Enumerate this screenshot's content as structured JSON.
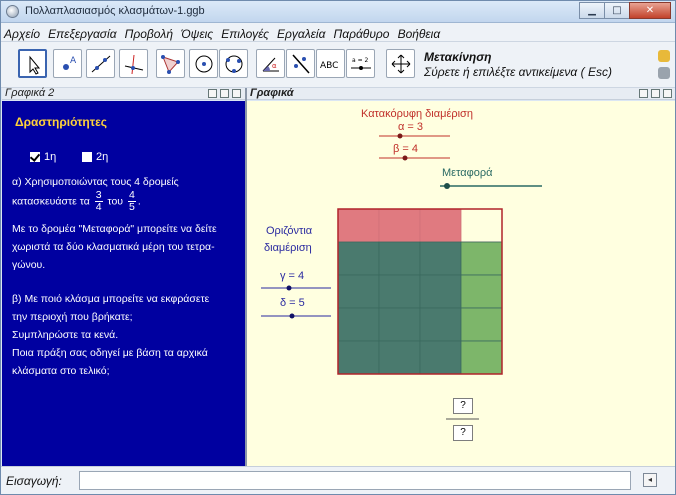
{
  "window": {
    "title": "Πολλαπλασιασμός κλασμάτων-1.ggb",
    "minimize": "▁",
    "maximize": "□",
    "close": "✕"
  },
  "menu": [
    "Αρχείο",
    "Επεξεργασία",
    "Προβολή",
    "Όψεις",
    "Επιλογές",
    "Εργαλεία",
    "Παράθυρο",
    "Βοήθεια"
  ],
  "toolbar": {
    "tools": [
      "move-tool",
      "point-tool",
      "line-tool",
      "perpendicular-tool",
      "polygon-tool",
      "circle-tool",
      "circle-three-points-tool",
      "angle-tool",
      "reflect-tool",
      "text-tool",
      "slider-tool",
      "move-view-tool"
    ],
    "text_tool_label": "ABC",
    "slider_tool_label": "a = 2",
    "active_tool_name": "Μετακίνηση",
    "active_tool_hint": "Σύρετε ή επιλέξτε αντικείμενα ( Esc)"
  },
  "left_panel": {
    "header": "Γραφικά 2",
    "title": "Δραστηριότητες",
    "checkbox1": "1η",
    "checkbox2": "2η",
    "checkbox1_checked": true,
    "checkbox2_checked": false,
    "q1_line1": "α) Χρησιμοποιώντας τους 4 δρομείς",
    "q1_line2_pre": "κατασκευάστε τα",
    "frac1_num": "3",
    "frac1_den": "4",
    "q1_line2_mid": "του",
    "frac2_num": "4",
    "frac2_den": "5",
    "q1_line2_post": ".",
    "q1_line3": "Με το δρομέα \"Μεταφορά\" μπορείτε να δείτε",
    "q1_line4": "χωριστά τα δύο κλασματικά μέρη του τετρα-",
    "q1_line5": "γώνου.",
    "q2_line1": "β) Με ποιό κλάσμα μπορείτε να εκφράσετε",
    "q2_line2": "την περιοχή που βρήκατε;",
    "q2_line3": "Συμπληρώστε τα κενά.",
    "q2_line4": "Ποια πράξη σας οδηγεί με βάση τα αρχικά",
    "q2_line5": "κλάσματα στο τελικό;"
  },
  "right_panel": {
    "header": "Γραφικά",
    "vertical_title": "Κατακόρυφη διαμέριση",
    "slider_a": "α = 3",
    "slider_b": "β = 4",
    "transfer_label": "Μεταφορά",
    "horizontal_title1": "Οριζόντια",
    "horizontal_title2": "διαμέριση",
    "slider_g": "γ = 4",
    "slider_d": "δ = 5",
    "answer_num": "?",
    "answer_den": "?",
    "grid": {
      "rows": 5,
      "cols": 4,
      "red_color": "#e07a80",
      "dark_color": "#4a7a6e",
      "green_color": "#7db66a",
      "light_color": "#ffffe0",
      "border_color": "#b0242a"
    }
  },
  "input_bar": {
    "label": "Εισαγωγή:",
    "value": "",
    "help_icon": "◂"
  }
}
